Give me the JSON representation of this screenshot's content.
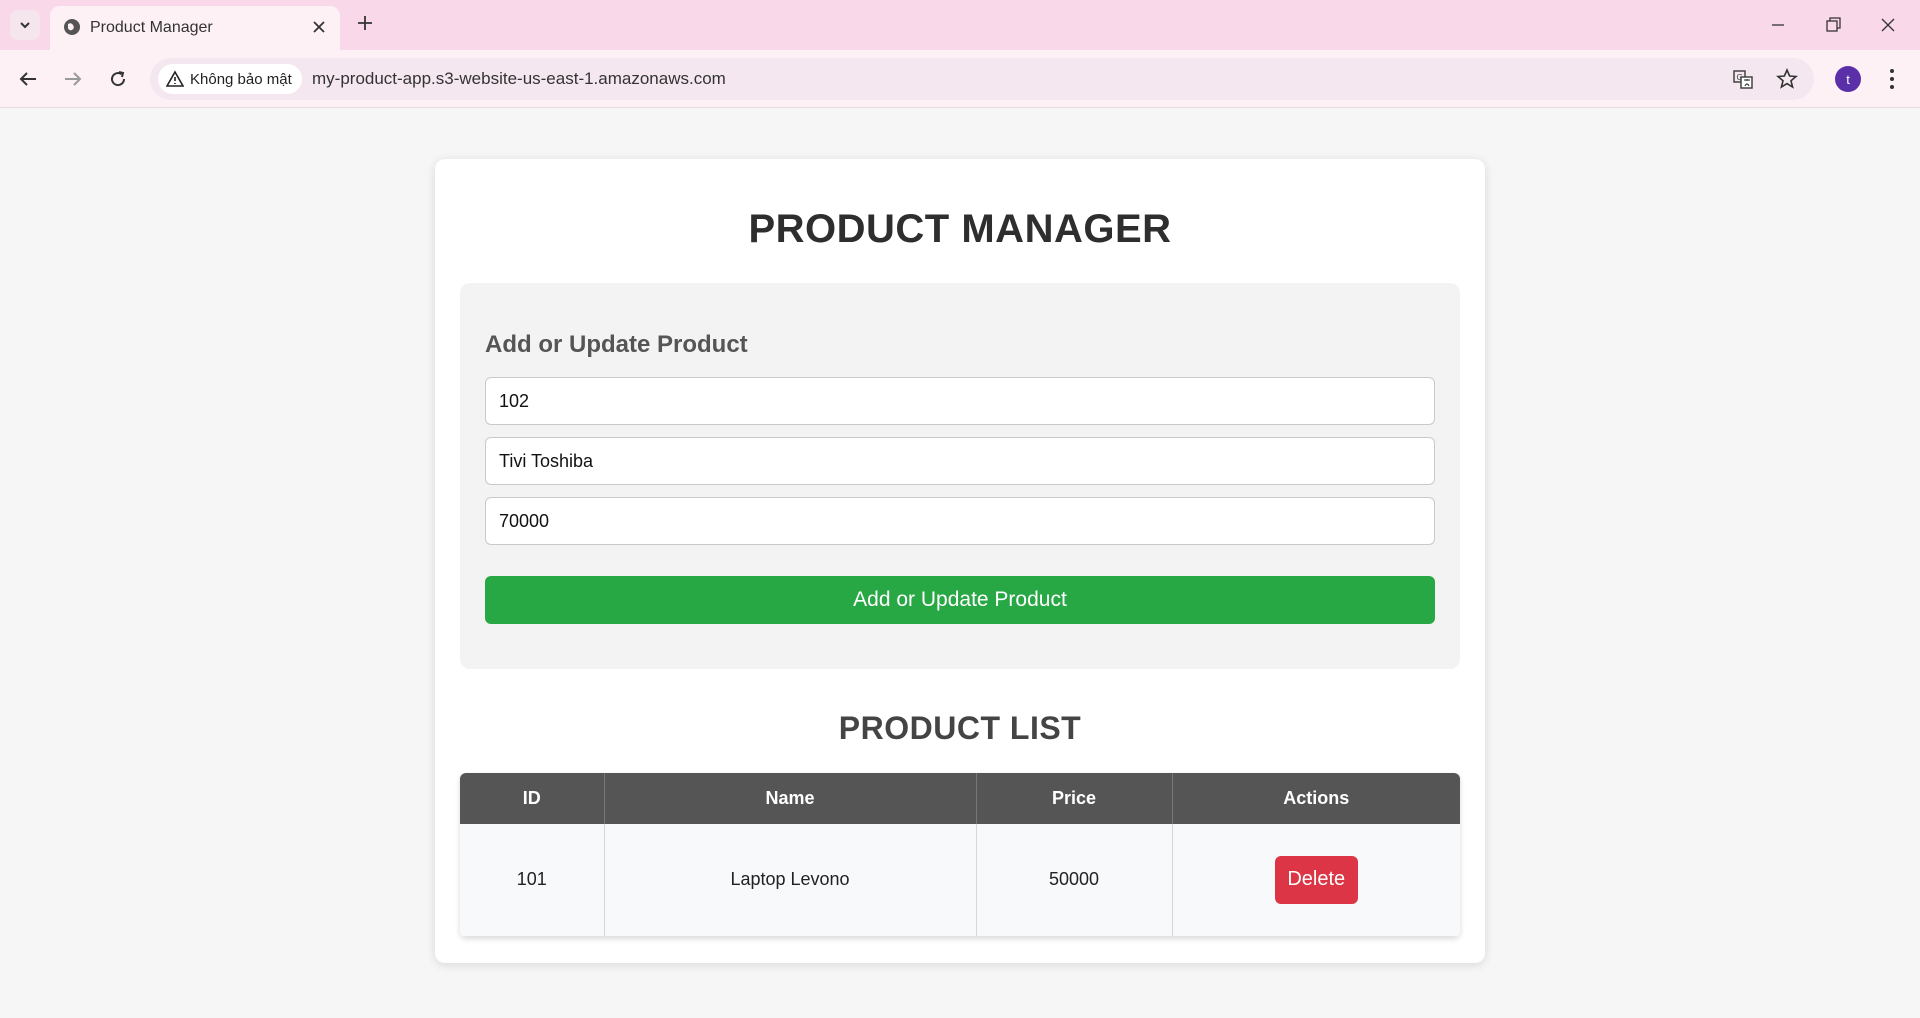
{
  "browser": {
    "tab_title": "Product Manager",
    "security_label": "Không bảo mật",
    "url": "my-product-app.s3-website-us-east-1.amazonaws.com",
    "profile_initial": "t"
  },
  "page": {
    "title": "PRODUCT MANAGER",
    "form": {
      "heading": "Add or Update Product",
      "id_value": "102",
      "name_value": "Tivi Toshiba",
      "price_value": "70000",
      "submit_label": "Add or Update Product"
    },
    "list": {
      "title": "PRODUCT LIST",
      "columns": [
        "ID",
        "Name",
        "Price",
        "Actions"
      ],
      "rows": [
        {
          "id": "101",
          "name": "Laptop Levono",
          "price": "50000",
          "action_label": "Delete"
        }
      ]
    }
  },
  "colors": {
    "submit": "#28a745",
    "delete": "#dc3545",
    "table_header": "#555555",
    "tab_strip": "#f9d9e9"
  }
}
